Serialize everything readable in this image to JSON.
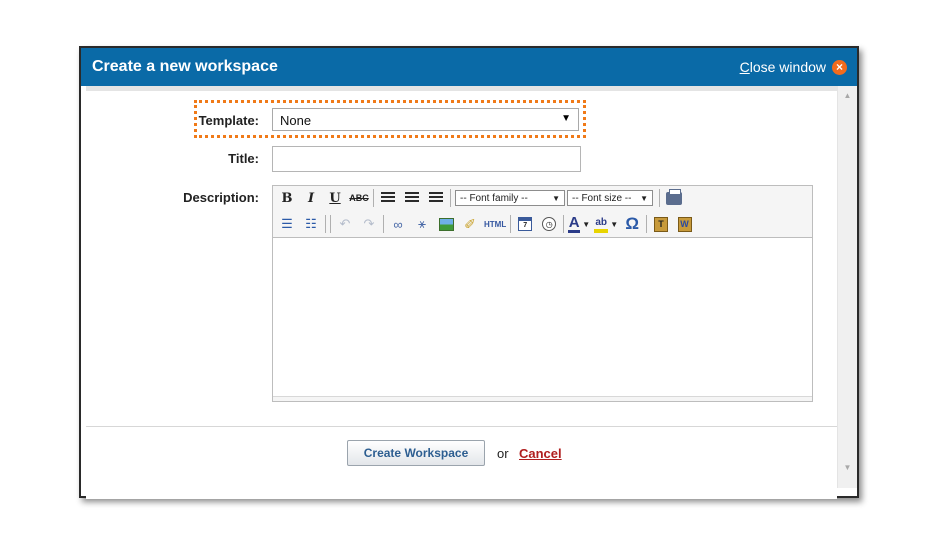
{
  "dialog": {
    "title": "Create a new workspace",
    "close_label_prefix": "C",
    "close_label_rest": "lose window",
    "close_icon": "×"
  },
  "form": {
    "template_label": "Template:",
    "template_value": "None",
    "title_label": "Title:",
    "title_value": "",
    "description_label": "Description:"
  },
  "editor": {
    "font_family_placeholder": "-- Font family --",
    "font_size_placeholder": "-- Font size --",
    "bold": "B",
    "italic": "I",
    "underline": "U",
    "strike": "ABC",
    "html": "HTML",
    "omega": "Ω",
    "font_color_glyph": "A",
    "highlight_glyph": "ab",
    "calendar_glyph": "7"
  },
  "footer": {
    "create_button": "Create Workspace",
    "or_text": "or",
    "cancel_link": "Cancel"
  },
  "colors": {
    "titlebar": "#0a6aa7",
    "template_highlight": "#f07a18",
    "cancel": "#b01e1e",
    "close_icon": "#f26b1d"
  }
}
